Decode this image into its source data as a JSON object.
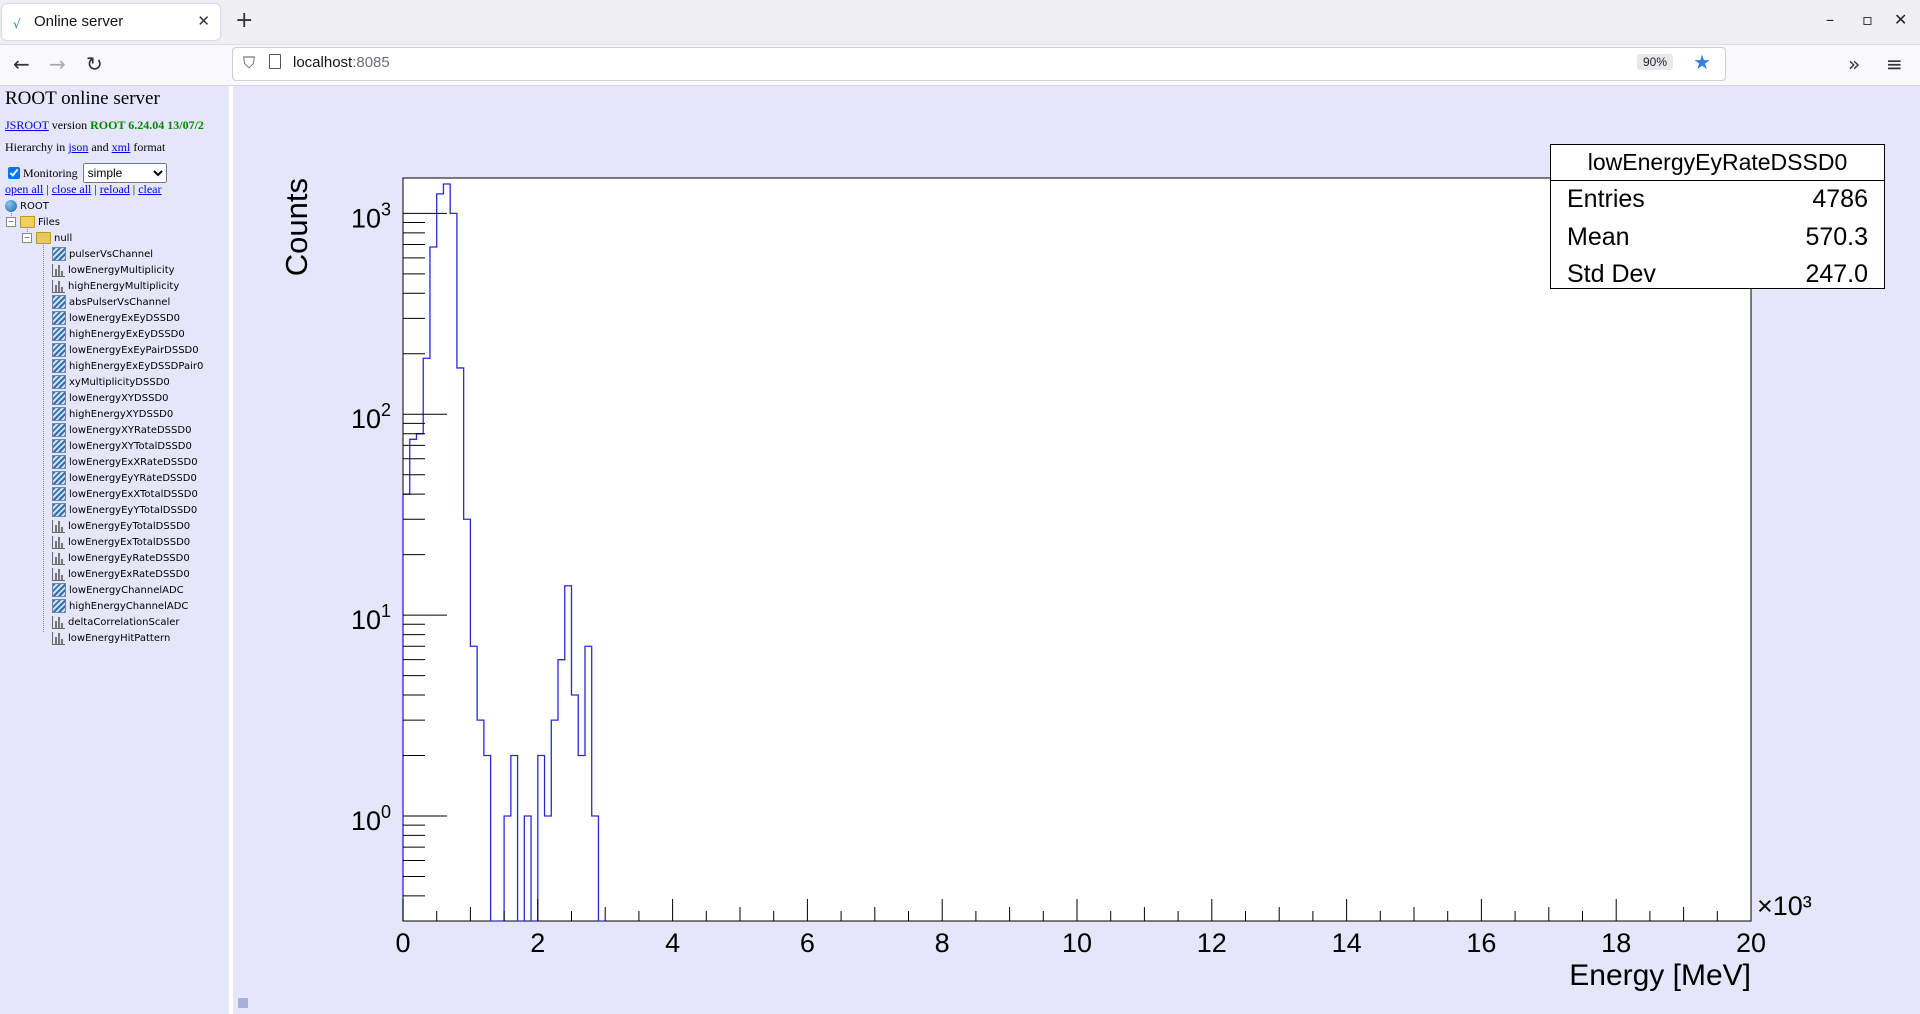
{
  "browser": {
    "tab_title": "Online server",
    "tab_favicon": "√",
    "new_tab": "+",
    "url_host": "localhost",
    "url_port": ":8085",
    "zoom": "90%"
  },
  "panel": {
    "title": "ROOT online server",
    "jsroot_link": "JSROOT",
    "version_word": "version",
    "version": "ROOT 6.24.04 13/07/2",
    "hierarchy_prefix": "Hierarchy in",
    "json_link": "json",
    "and_word": "and",
    "xml_link": "xml",
    "format_word": "format",
    "monitoring_label": "Monitoring",
    "monitoring_option": "simple",
    "open_all": "open all",
    "close_all": "close all",
    "reload": "reload",
    "clear": "clear",
    "sep": "|"
  },
  "tree": {
    "root_label": "ROOT",
    "files_label": "Files",
    "file_label": "null",
    "items": [
      {
        "label": "pulserVsChannel",
        "kind": "h2"
      },
      {
        "label": "lowEnergyMultiplicity",
        "kind": "h1"
      },
      {
        "label": "highEnergyMultiplicity",
        "kind": "h1"
      },
      {
        "label": "absPulserVsChannel",
        "kind": "h2"
      },
      {
        "label": "lowEnergyExEyDSSD0",
        "kind": "h2"
      },
      {
        "label": "highEnergyExEyDSSD0",
        "kind": "h2"
      },
      {
        "label": "lowEnergyExEyPairDSSD0",
        "kind": "h2"
      },
      {
        "label": "highEnergyExEyDSSDPair0",
        "kind": "h2"
      },
      {
        "label": "xyMultiplicityDSSD0",
        "kind": "h2"
      },
      {
        "label": "lowEnergyXYDSSD0",
        "kind": "h2"
      },
      {
        "label": "highEnergyXYDSSD0",
        "kind": "h2"
      },
      {
        "label": "lowEnergyXYRateDSSD0",
        "kind": "h2"
      },
      {
        "label": "lowEnergyXYTotalDSSD0",
        "kind": "h2"
      },
      {
        "label": "lowEnergyExXRateDSSD0",
        "kind": "h2"
      },
      {
        "label": "lowEnergyEyYRateDSSD0",
        "kind": "h2"
      },
      {
        "label": "lowEnergyExXTotalDSSD0",
        "kind": "h2"
      },
      {
        "label": "lowEnergyEyYTotalDSSD0",
        "kind": "h2"
      },
      {
        "label": "lowEnergyEyTotalDSSD0",
        "kind": "h1"
      },
      {
        "label": "lowEnergyExTotalDSSD0",
        "kind": "h1"
      },
      {
        "label": "lowEnergyEyRateDSSD0",
        "kind": "h1"
      },
      {
        "label": "lowEnergyExRateDSSD0",
        "kind": "h1"
      },
      {
        "label": "lowEnergyChannelADC",
        "kind": "h2"
      },
      {
        "label": "highEnergyChannelADC",
        "kind": "h2"
      },
      {
        "label": "deltaCorrelationScaler",
        "kind": "h1"
      },
      {
        "label": "lowEnergyHitPattern",
        "kind": "h1"
      }
    ]
  },
  "stats": {
    "title": "lowEnergyEyRateDSSD0",
    "rows": [
      {
        "label": "Entries",
        "value": "4786"
      },
      {
        "label": "Mean",
        "value": "570.3"
      },
      {
        "label": "Std Dev",
        "value": "247.0"
      }
    ]
  },
  "colors": {
    "accent_line": "#2a2ad4",
    "canvas_bg": "#e6e6fa",
    "link": "#0000ee",
    "version_green": "#008800"
  },
  "chart_data": {
    "type": "bar",
    "histogram": true,
    "xlabel": "Energy [MeV]",
    "ylabel": "Counts",
    "x_multiplier": "×10³",
    "xlim": [
      0,
      20000
    ],
    "ylim": [
      0.3,
      1500
    ],
    "log_y": true,
    "x_ticks": [
      "0",
      "2",
      "4",
      "6",
      "8",
      "10",
      "12",
      "14",
      "16",
      "18",
      "20"
    ],
    "y_ticks": [
      {
        "base": "10",
        "exp": "0"
      },
      {
        "base": "10",
        "exp": "1"
      },
      {
        "base": "10",
        "exp": "2"
      },
      {
        "base": "10",
        "exp": "3"
      }
    ],
    "bin_width": 100,
    "bins": [
      {
        "x": 0,
        "y": 40
      },
      {
        "x": 100,
        "y": 75
      },
      {
        "x": 200,
        "y": 80
      },
      {
        "x": 300,
        "y": 190
      },
      {
        "x": 400,
        "y": 680
      },
      {
        "x": 500,
        "y": 1250
      },
      {
        "x": 600,
        "y": 1400
      },
      {
        "x": 700,
        "y": 1000
      },
      {
        "x": 800,
        "y": 170
      },
      {
        "x": 900,
        "y": 30
      },
      {
        "x": 1000,
        "y": 7
      },
      {
        "x": 1100,
        "y": 3
      },
      {
        "x": 1200,
        "y": 2
      },
      {
        "x": 1300,
        "y": 0
      },
      {
        "x": 1400,
        "y": 0
      },
      {
        "x": 1500,
        "y": 1
      },
      {
        "x": 1600,
        "y": 2
      },
      {
        "x": 1700,
        "y": 0
      },
      {
        "x": 1800,
        "y": 1
      },
      {
        "x": 1900,
        "y": 0
      },
      {
        "x": 2000,
        "y": 2
      },
      {
        "x": 2100,
        "y": 1
      },
      {
        "x": 2200,
        "y": 3
      },
      {
        "x": 2300,
        "y": 6
      },
      {
        "x": 2400,
        "y": 14
      },
      {
        "x": 2500,
        "y": 4
      },
      {
        "x": 2600,
        "y": 2
      },
      {
        "x": 2700,
        "y": 7
      },
      {
        "x": 2800,
        "y": 1
      },
      {
        "x": 2900,
        "y": 0
      }
    ]
  }
}
